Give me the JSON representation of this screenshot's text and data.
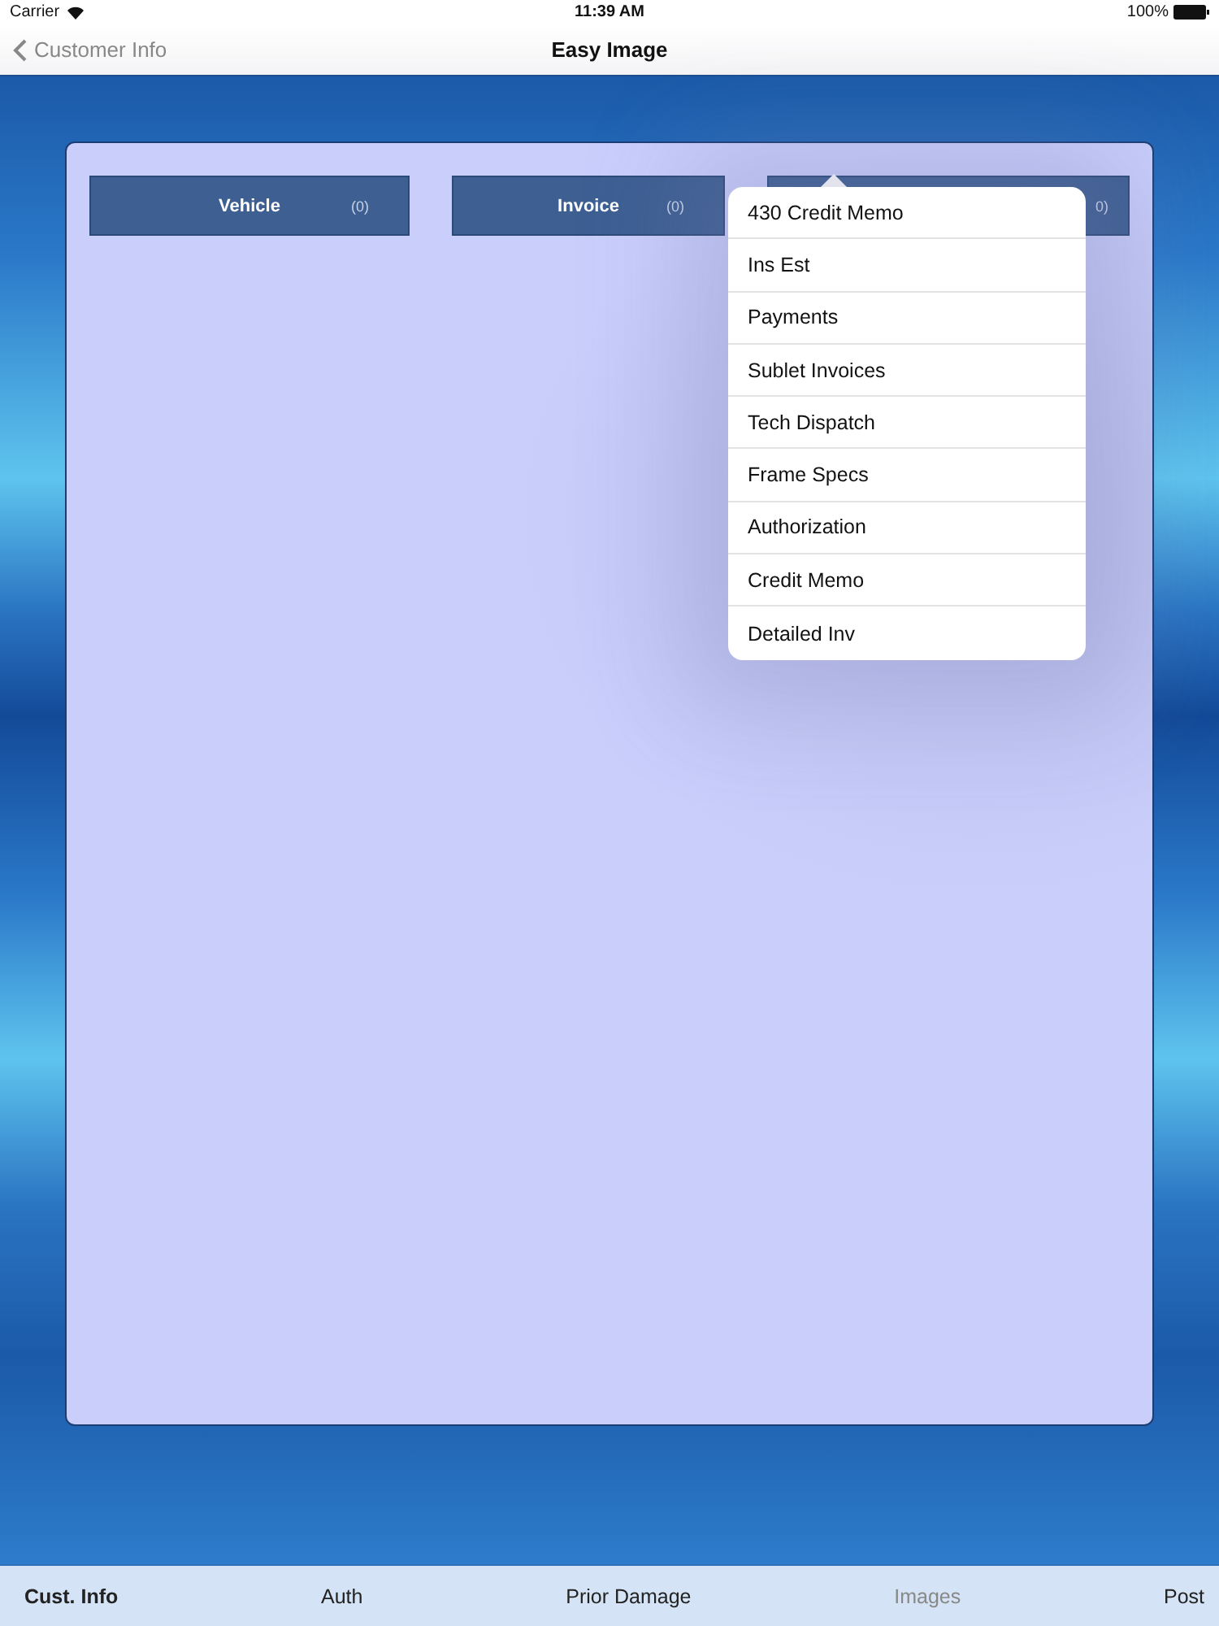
{
  "status_bar": {
    "carrier": "Carrier",
    "time": "11:39 AM",
    "battery": "100%"
  },
  "nav_bar": {
    "back": "Customer Info",
    "title": "Easy Image"
  },
  "categories": [
    {
      "label": "Vehicle",
      "count": "(0)"
    },
    {
      "label": "Invoice",
      "count": "(0)"
    },
    {
      "count": "0)"
    }
  ],
  "popover": {
    "items": [
      "430 Credit Memo",
      "Ins Est",
      "Payments",
      "Sublet Invoices",
      "Tech Dispatch",
      "Frame Specs",
      "Authorization",
      "Credit Memo",
      "Detailed Inv"
    ]
  },
  "tab_bar": [
    {
      "label": "Cust. Info",
      "selected": true,
      "disabled": false
    },
    {
      "label": "Auth",
      "selected": false,
      "disabled": false
    },
    {
      "label": "Prior Damage",
      "selected": false,
      "disabled": false
    },
    {
      "label": "Images",
      "selected": false,
      "disabled": true
    },
    {
      "label": "Post",
      "selected": false,
      "disabled": false
    }
  ]
}
